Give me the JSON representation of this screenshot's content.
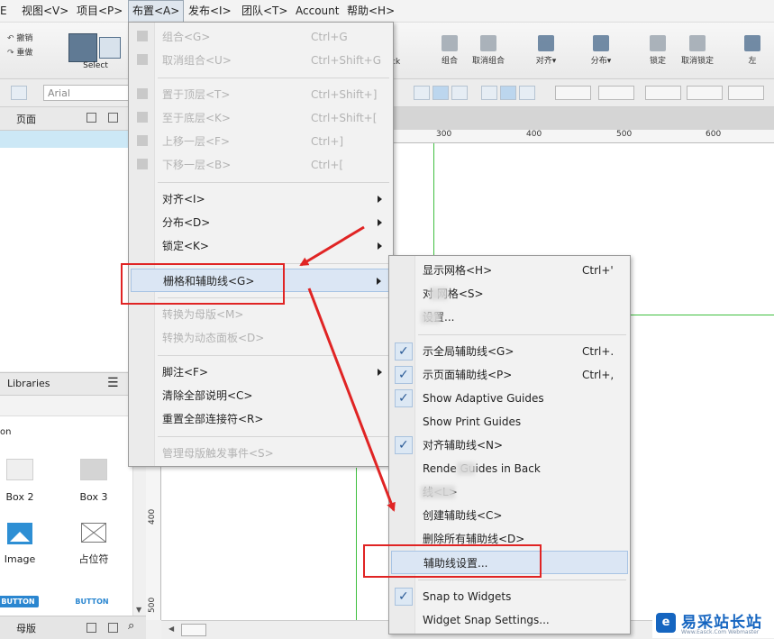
{
  "menubar": {
    "items": [
      "E",
      "视图<V>",
      "项目<P>",
      "布置<A>",
      "发布<I>",
      "团队<T>",
      "Account",
      "帮助<H>"
    ]
  },
  "toolbar": {
    "undo": "撤销",
    "redo": "重做",
    "select": "Select",
    "back_fragment": "ck",
    "group": "组合",
    "ungroup": "取消组合",
    "align": "对齐▾",
    "distribute": "分布▾",
    "lock": "锁定",
    "unlock": "取消锁定",
    "left": "左"
  },
  "formatbar": {
    "font": "Arial"
  },
  "pages_panel": {
    "title": "页面"
  },
  "libraries_panel": {
    "title": "Libraries",
    "sub_label": "on",
    "widgets": [
      "Box 2",
      "Box 3",
      "Image",
      "占位符"
    ],
    "buttons": [
      "BUTTON",
      "BUTTON"
    ]
  },
  "masters_panel": {
    "title": "母版"
  },
  "ruler": {
    "h_marks": [
      "300",
      "400",
      "500",
      "600"
    ],
    "v_marks": [
      "400",
      "500"
    ]
  },
  "arrange_menu": {
    "items": [
      {
        "label": "组合<G>",
        "shortcut": "Ctrl+G"
      },
      {
        "label": "取消组合<U>",
        "shortcut": "Ctrl+Shift+G"
      },
      {
        "label": "置于顶层<T>",
        "shortcut": "Ctrl+Shift+]"
      },
      {
        "label": "至于底层<K>",
        "shortcut": "Ctrl+Shift+["
      },
      {
        "label": "上移一层<F>",
        "shortcut": "Ctrl+]"
      },
      {
        "label": "下移一层<B>",
        "shortcut": "Ctrl+["
      },
      {
        "label": "对齐<I>",
        "shortcut": ""
      },
      {
        "label": "分布<D>",
        "shortcut": ""
      },
      {
        "label": "锁定<K>",
        "shortcut": ""
      },
      {
        "label": "栅格和辅助线<G>",
        "shortcut": ""
      },
      {
        "label": "转换为母版<M>",
        "shortcut": ""
      },
      {
        "label": "转换为动态面板<D>",
        "shortcut": ""
      },
      {
        "label": "脚注<F>",
        "shortcut": ""
      },
      {
        "label": "清除全部说明<C>",
        "shortcut": ""
      },
      {
        "label": "重置全部连接符<R>",
        "shortcut": ""
      },
      {
        "label": "管理母版触发事件<S>",
        "shortcut": ""
      }
    ]
  },
  "grid_menu": {
    "items": [
      {
        "label": "显示网格<H>",
        "shortcut": "Ctrl+'"
      },
      {
        "label": "对  网格<S>",
        "shortcut": ""
      },
      {
        "label": "  设置...",
        "shortcut": ""
      },
      {
        "label": "  示全局辅助线<G>",
        "shortcut": "Ctrl+."
      },
      {
        "label": "  示页面辅助线<P>",
        "shortcut": "Ctrl+,"
      },
      {
        "label": "Show Adaptive Guides",
        "shortcut": ""
      },
      {
        "label": "Show Print Guides",
        "shortcut": ""
      },
      {
        "label": "对齐辅助线<N>",
        "shortcut": ""
      },
      {
        "label": "Rende   Guides in Back",
        "shortcut": ""
      },
      {
        "label": "      线<L>",
        "shortcut": ""
      },
      {
        "label": "创建辅助线<C>",
        "shortcut": ""
      },
      {
        "label": "删除所有辅助线<D>",
        "shortcut": ""
      },
      {
        "label": "辅助线设置...",
        "shortcut": ""
      },
      {
        "label": "Snap to Widgets",
        "shortcut": ""
      },
      {
        "label": "Widget Snap Settings...",
        "shortcut": ""
      }
    ],
    "check_mark": "✓"
  },
  "watermark": {
    "logo": "e",
    "text": "易采站长站",
    "sub": "Www.Easck.Com  Webmaster"
  },
  "colors": {
    "annotation_red": "#e02424",
    "guide_green": "#3fbf3f",
    "highlight_blue": "#cce8f6"
  }
}
